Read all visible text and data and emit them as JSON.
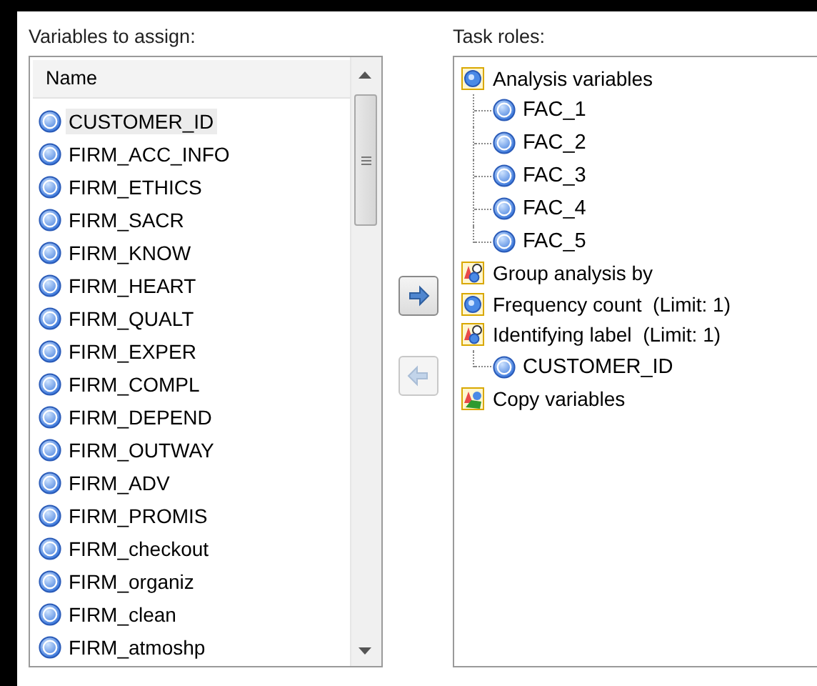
{
  "variables_panel": {
    "label": "Variables to assign:",
    "column": "Name",
    "items": [
      {
        "name": "CUSTOMER_ID",
        "selected": true
      },
      {
        "name": "FIRM_ACC_INFO",
        "selected": false
      },
      {
        "name": "FIRM_ETHICS",
        "selected": false
      },
      {
        "name": "FIRM_SACR",
        "selected": false
      },
      {
        "name": "FIRM_KNOW",
        "selected": false
      },
      {
        "name": "FIRM_HEART",
        "selected": false
      },
      {
        "name": "FIRM_QUALT",
        "selected": false
      },
      {
        "name": "FIRM_EXPER",
        "selected": false
      },
      {
        "name": "FIRM_COMPL",
        "selected": false
      },
      {
        "name": "FIRM_DEPEND",
        "selected": false
      },
      {
        "name": "FIRM_OUTWAY",
        "selected": false
      },
      {
        "name": "FIRM_ADV",
        "selected": false
      },
      {
        "name": "FIRM_PROMIS",
        "selected": false
      },
      {
        "name": "FIRM_checkout",
        "selected": false
      },
      {
        "name": "FIRM_organiz",
        "selected": false
      },
      {
        "name": "FIRM_clean",
        "selected": false
      },
      {
        "name": "FIRM_atmoshp",
        "selected": false
      }
    ]
  },
  "move_buttons": [
    {
      "kind": "add",
      "disabled": false
    },
    {
      "kind": "remove",
      "disabled": true
    }
  ],
  "roles_panel": {
    "label": "Task roles:",
    "roles": [
      {
        "name": "Analysis variables",
        "kind": "numeric",
        "children": [
          "FAC_1",
          "FAC_2",
          "FAC_3",
          "FAC_4",
          "FAC_5"
        ]
      },
      {
        "name": "Group analysis by",
        "kind": "group"
      },
      {
        "name": "Frequency count  (Limit: 1)",
        "kind": "numeric"
      },
      {
        "name": "Identifying label  (Limit: 1)",
        "kind": "group",
        "children": [
          "CUSTOMER_ID"
        ]
      },
      {
        "name": "Copy variables",
        "kind": "copy"
      }
    ]
  }
}
